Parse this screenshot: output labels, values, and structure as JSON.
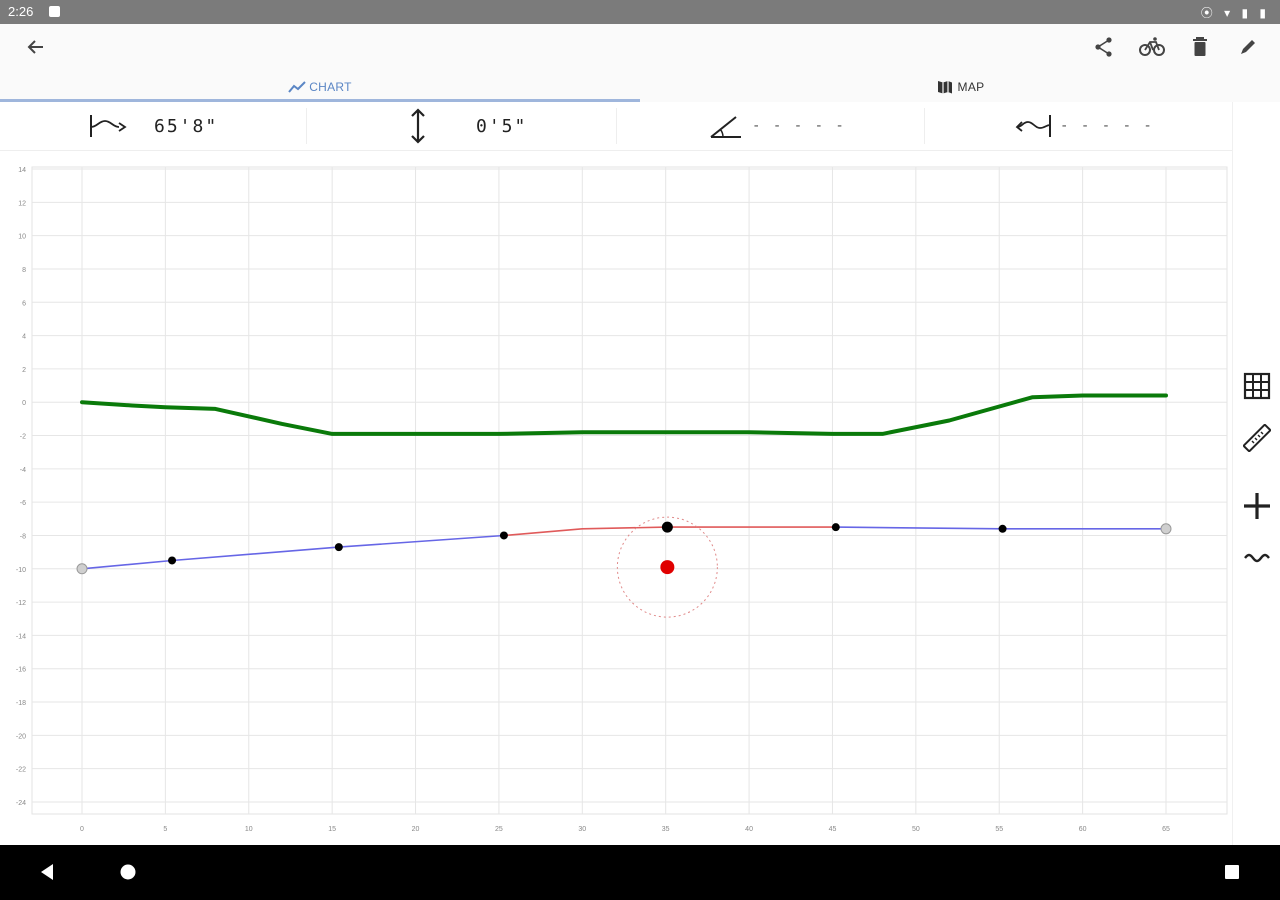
{
  "status_bar": {
    "time": "2:26",
    "system_icons": "⦿ ▾ ▮ ▮"
  },
  "app_bar": {
    "back": "back-arrow-icon",
    "actions": [
      "share-icon",
      "bicycle-icon",
      "trash-icon",
      "pencil-icon"
    ]
  },
  "tabs": [
    {
      "label": "CHART",
      "icon": "chart-line-icon",
      "active": true
    },
    {
      "label": "MAP",
      "icon": "map-icon",
      "active": false
    }
  ],
  "metrics": {
    "distance": {
      "icon": "distance-icon",
      "value": "65'8\""
    },
    "height": {
      "icon": "height-arrows-icon",
      "value": "0'5\""
    },
    "angle": {
      "icon": "angle-icon",
      "value": "- - - - -"
    },
    "width": {
      "icon": "width-icon",
      "value": "- - - - -"
    }
  },
  "chart_data": {
    "type": "line",
    "xlim": [
      0,
      65
    ],
    "ylim": [
      -24,
      14
    ],
    "x_ticks": [
      0,
      5,
      10,
      15,
      20,
      25,
      30,
      35,
      40,
      45,
      50,
      55,
      60,
      65
    ],
    "y_ticks": [
      14,
      12,
      10,
      8,
      6,
      4,
      2,
      0,
      -2,
      -4,
      -6,
      -8,
      -10,
      -12,
      -14,
      -16,
      -18,
      -20,
      -22,
      -24
    ],
    "grid": true,
    "series": [
      {
        "color": "#0a7a0a",
        "x": [
          0,
          3,
          5,
          8,
          12,
          15,
          18,
          25,
          30,
          35,
          40,
          45,
          48,
          52,
          57,
          60,
          65
        ],
        "y": [
          0,
          -0.2,
          -0.3,
          -0.4,
          -1.3,
          -1.9,
          -1.9,
          -1.9,
          -1.8,
          -1.8,
          -1.8,
          -1.9,
          -1.9,
          -1.1,
          0.3,
          0.4,
          0.4
        ]
      },
      {
        "color": "#6666e6",
        "x": [
          0,
          5.4,
          15.4,
          25.3
        ],
        "y": [
          -10,
          -9.5,
          -8.7,
          -8
        ]
      },
      {
        "color": "#e05a5a",
        "x": [
          25.3,
          30,
          35.1,
          45.2
        ],
        "y": [
          -8,
          -7.6,
          -7.5,
          -7.5
        ]
      },
      {
        "color": "#6666e6",
        "x": [
          45.2,
          55.2,
          65
        ],
        "y": [
          -7.5,
          -7.6,
          -7.6
        ]
      }
    ],
    "points": [
      {
        "x": 0,
        "y": -10,
        "kind": "end"
      },
      {
        "x": 5.4,
        "y": -9.5,
        "kind": "node"
      },
      {
        "x": 15.4,
        "y": -8.7,
        "kind": "node"
      },
      {
        "x": 25.3,
        "y": -8,
        "kind": "node"
      },
      {
        "x": 35.1,
        "y": -7.5,
        "kind": "selected"
      },
      {
        "x": 45.2,
        "y": -7.5,
        "kind": "node"
      },
      {
        "x": 55.2,
        "y": -7.6,
        "kind": "node"
      },
      {
        "x": 65,
        "y": -7.6,
        "kind": "end"
      }
    ],
    "control_point": {
      "x": 35.1,
      "y": -9.9
    }
  },
  "right_toolbar": [
    "grid-icon",
    "ruler-icon",
    "add-icon",
    "wave-icon"
  ],
  "nav_bar": [
    "nav-back-icon",
    "nav-home-icon",
    "nav-recents-icon"
  ]
}
